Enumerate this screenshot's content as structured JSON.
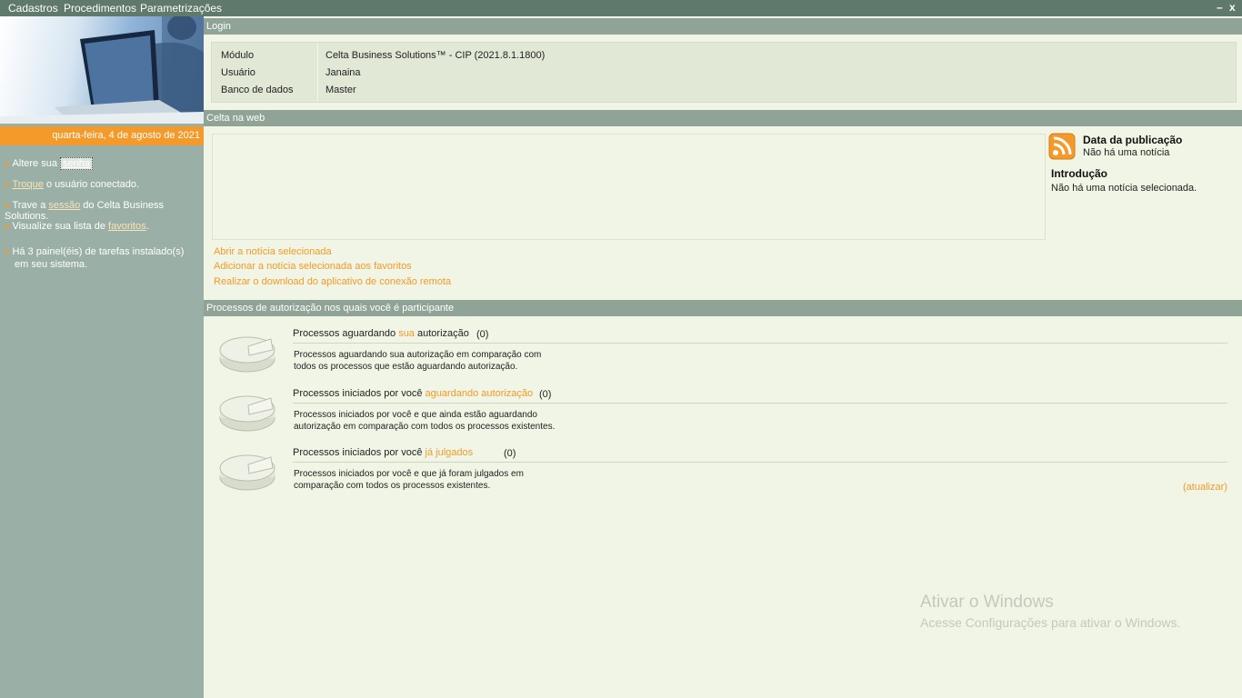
{
  "menubar": {
    "items": [
      "Cadastros",
      "Procedimentos",
      "Parametrizações"
    ],
    "minimize": "–",
    "close": "x"
  },
  "sidebar": {
    "date": "quarta-feira, 4 de agosto de 2021",
    "items": [
      {
        "pre": "Altere sua ",
        "link": "senha",
        "post": ""
      },
      {
        "pre": "",
        "link": "Troque",
        "post": " o usuário conectado."
      },
      {
        "pre": "Trave a ",
        "link": "sessão",
        "post": " do Celta Business Solutions."
      },
      {
        "pre": "Visualize sua lista de ",
        "link": "favoritos",
        "post": "."
      }
    ],
    "panels_line1": "Há 3 painel(éis) de tarefas instalado(s)",
    "panels_line2": "em seu sistema."
  },
  "login": {
    "header": "Login",
    "rows": [
      {
        "label": "Módulo",
        "value": "Celta Business Solutions™ - CIP (2021.8.1.1800)"
      },
      {
        "label": "Usuário",
        "value": "Janaina"
      },
      {
        "label": "Banco de dados",
        "value": "Master"
      }
    ]
  },
  "web": {
    "header": "Celta na web",
    "pub_title": "Data da publicação",
    "pub_text": "Não há uma notícia",
    "intro_title": "Introdução",
    "intro_text": "Não há uma notícia selecionada.",
    "links": [
      "Abrir a notícia selecionada",
      "Adicionar a notícia selecionada aos favoritos",
      "Realizar o download do aplicativo de conexão remota"
    ]
  },
  "processes": {
    "header": "Processos de autorização nos quais você é participante",
    "items": [
      {
        "pre": "Processos aguardando ",
        "hl": "sua",
        "post": " autorização",
        "count": "(0)",
        "desc1": "Processos aguardando sua autorização em comparação com",
        "desc2": "todos os processos que estão aguardando autorização."
      },
      {
        "pre": "Processos iniciados por você ",
        "hl": "aguardando autorização",
        "post": "",
        "count": "(0)",
        "desc1": "Processos iniciados por você e que ainda estão aguardando",
        "desc2": "autorização em comparação com todos os processos existentes."
      },
      {
        "pre": "Processos iniciados por você ",
        "hl": "já julgados",
        "post": "",
        "count": "(0)",
        "desc1": "Processos iniciados por você e que já foram julgados em",
        "desc2": "comparação com todos os processos existentes."
      }
    ],
    "refresh": "(atualizar)"
  },
  "watermark": {
    "title": "Ativar o Windows",
    "subtitle": "Acesse Configurações para ativar o Windows."
  },
  "colors": {
    "accent": "#f39a2a",
    "header": "#8fa497",
    "sidebar": "#9ab0a6",
    "menubar": "#5f7a6c"
  }
}
